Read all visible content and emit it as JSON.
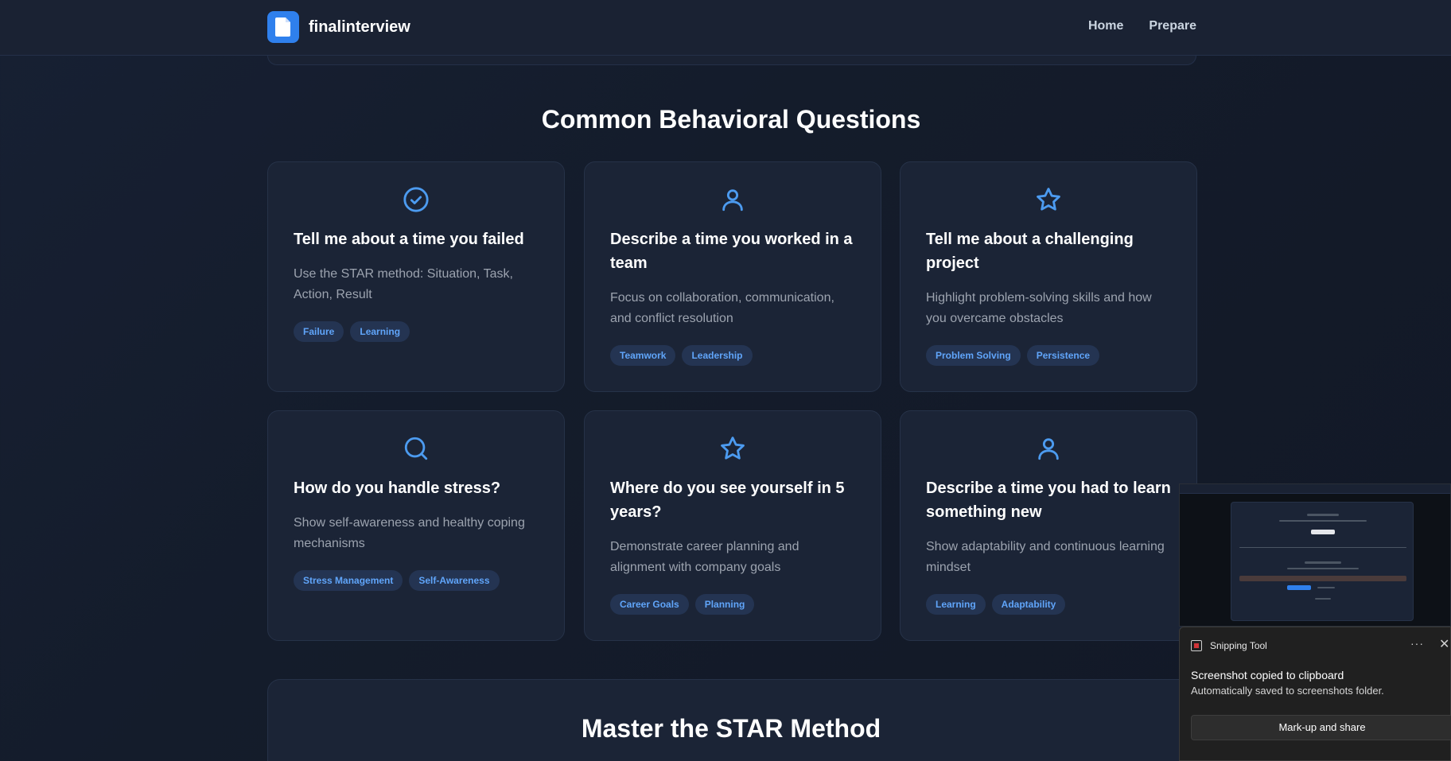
{
  "nav": {
    "brand": "finalinterview",
    "links": [
      "Home",
      "Prepare"
    ]
  },
  "section_title": "Common Behavioral Questions",
  "cards": [
    {
      "icon": "check-circle-icon",
      "title": "Tell me about a time you failed",
      "description": "Use the STAR method: Situation, Task, Action, Result",
      "tags": [
        "Failure",
        "Learning"
      ]
    },
    {
      "icon": "user-icon",
      "title": "Describe a time you worked in a team",
      "description": "Focus on collaboration, communication, and conflict resolution",
      "tags": [
        "Teamwork",
        "Leadership"
      ]
    },
    {
      "icon": "star-icon",
      "title": "Tell me about a challenging project",
      "description": "Highlight problem-solving skills and how you overcame obstacles",
      "tags": [
        "Problem Solving",
        "Persistence"
      ]
    },
    {
      "icon": "search-icon",
      "title": "How do you handle stress?",
      "description": "Show self-awareness and healthy coping mechanisms",
      "tags": [
        "Stress Management",
        "Self-Awareness"
      ]
    },
    {
      "icon": "star-icon",
      "title": "Where do you see yourself in 5 years?",
      "description": "Demonstrate career planning and alignment with company goals",
      "tags": [
        "Career Goals",
        "Planning"
      ]
    },
    {
      "icon": "user-icon",
      "title": "Describe a time you had to learn something new",
      "description": "Show adaptability and continuous learning mindset",
      "tags": [
        "Learning",
        "Adaptability"
      ]
    }
  ],
  "star_section_title": "Master the STAR Method",
  "snipping_tool": {
    "app_name": "Snipping Tool",
    "more": "···",
    "close": "✕",
    "title": "Screenshot copied to clipboard",
    "body": "Automatically saved to screenshots folder.",
    "button": "Mark-up and share"
  },
  "colors": {
    "accent": "#4c9bf0",
    "background": "#141c2b",
    "card": "#1b2436"
  }
}
